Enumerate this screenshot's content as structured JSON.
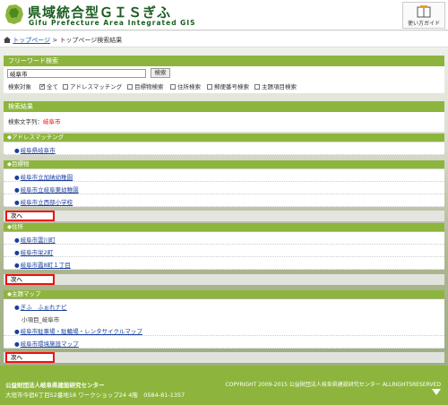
{
  "header": {
    "title": "県域統合型ＧＩＳぎふ",
    "subtitle": "Gifu Prefecture Area Integrated GIS",
    "guide_label": "使い方ガイド"
  },
  "breadcrumb": {
    "link": "トップページ",
    "separator": " > ",
    "current": "トップページ検索結果"
  },
  "freeword": {
    "heading": "フリーワード検索",
    "input_value": "岐阜市",
    "search_button": "検索",
    "target_label": "検索対象",
    "options": [
      {
        "label": "全て",
        "checked": true
      },
      {
        "label": "アドレスマッチング",
        "checked": false
      },
      {
        "label": "目標物検索",
        "checked": false
      },
      {
        "label": "住所検索",
        "checked": false
      },
      {
        "label": "郵便番号検索",
        "checked": false
      },
      {
        "label": "主題項目検索",
        "checked": false
      }
    ]
  },
  "results": {
    "heading": "検索結果",
    "query_label": "検索文字列：",
    "query_value": "岐阜市",
    "next_label": "次へ",
    "categories": [
      {
        "heading": "◆アドレスマッチング",
        "items": [
          "岐阜県岐阜市"
        ]
      },
      {
        "heading": "◆目標物",
        "items": [
          "岐阜市立加納幼稚園",
          "岐阜市立岐阜東幼稚園",
          "岐阜市立西部小学校"
        ]
      },
      {
        "heading": "◆住所",
        "items": [
          "岐阜市雲川町",
          "岐阜市栄2町",
          "岐阜市霞8町１丁目"
        ]
      },
      {
        "heading": "◆主題マップ",
        "items": [
          "ぎふ　ふぉれナビ",
          "岐阜市駐車場・駐輪場・レンタサイクルマップ",
          "岐阜市環境施設マップ"
        ],
        "sub": "小項目_岐阜市"
      }
    ]
  },
  "footer": {
    "org": "公益財団法人岐阜県建設研究センター",
    "address": "大垣市今宿6丁目52番地18 ワークショップ24 4階　0584-81-1357",
    "copyright": "COPYRIGHT 2009-2015 公益財団法人岐阜県建設研究センター ALLRIGHTSRESERVED"
  },
  "colors": {
    "accent": "#8db53d",
    "title": "#1b5e20",
    "link": "#1a3f9c",
    "highlight": "#ee1111"
  }
}
